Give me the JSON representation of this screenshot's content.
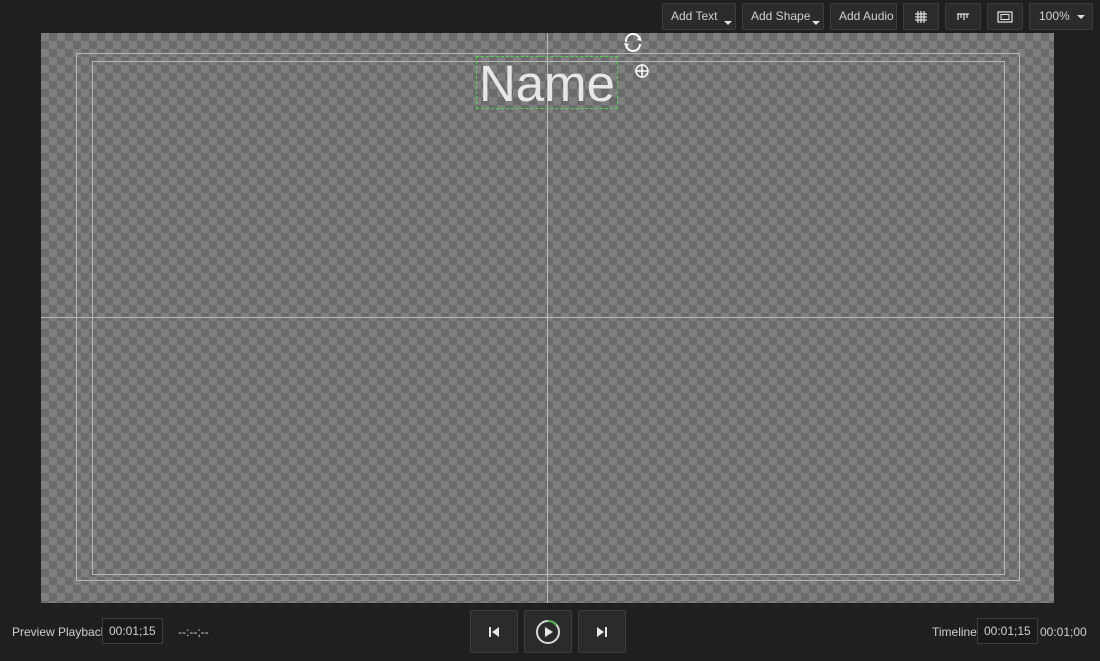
{
  "toolbar": {
    "add_text": "Add Text",
    "add_shape": "Add Shape",
    "add_audio": "Add Audio",
    "icons": [
      "grid-icon",
      "ruler-icon",
      "safe-area-icon"
    ],
    "zoom_value": "100%"
  },
  "canvas": {
    "text_layer": "Name"
  },
  "playback": {
    "preview_label": "Preview Playback",
    "preview_timecode": "00:01;15",
    "preview_secondary": "--:--;--",
    "timeline_label": "Timeline",
    "timeline_timecode": "00:01;15",
    "timeline_duration": "00:01;00"
  },
  "colors": {
    "background": "#1f1f1f",
    "selection": "#4fd04f",
    "guide": "#b8b8b8"
  }
}
